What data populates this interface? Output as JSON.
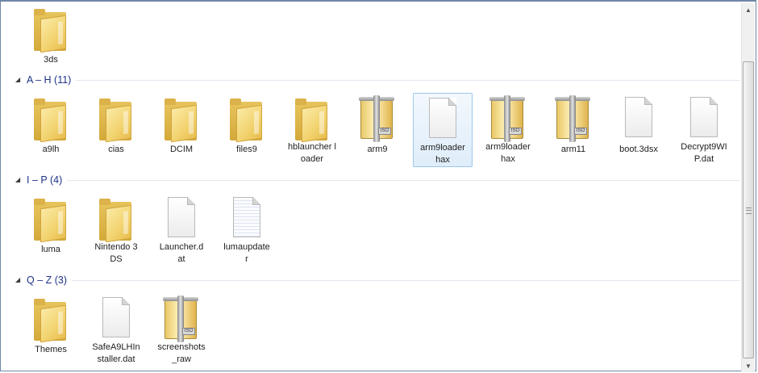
{
  "top_items": [
    {
      "label": "3ds",
      "icon": "folder"
    }
  ],
  "groups": [
    {
      "title": "A – H (11)",
      "items": [
        {
          "label": "a9lh",
          "icon": "folder"
        },
        {
          "label": "cias",
          "icon": "folder"
        },
        {
          "label": "DCIM",
          "icon": "folder"
        },
        {
          "label": "files9",
          "icon": "folder"
        },
        {
          "label": "hblauncher loader",
          "icon": "folder"
        },
        {
          "label": "arm9",
          "icon": "iso"
        },
        {
          "label": "arm9loader hax",
          "icon": "document",
          "selected": true
        },
        {
          "label": "arm9loader hax",
          "icon": "iso"
        },
        {
          "label": "arm11",
          "icon": "iso"
        },
        {
          "label": "boot.3dsx",
          "icon": "document"
        },
        {
          "label": "Decrypt9WIP.dat",
          "icon": "document"
        }
      ]
    },
    {
      "title": "I – P (4)",
      "items": [
        {
          "label": "luma",
          "icon": "folder"
        },
        {
          "label": "Nintendo 3DS",
          "icon": "folder"
        },
        {
          "label": "Launcher.dat",
          "icon": "document"
        },
        {
          "label": "lumaupdater",
          "icon": "document-lined"
        }
      ]
    },
    {
      "title": "Q – Z (3)",
      "items": [
        {
          "label": "Themes",
          "icon": "folder"
        },
        {
          "label": "SafeA9LHInstaller.dat",
          "icon": "document"
        },
        {
          "label": "screenshots_raw",
          "icon": "iso"
        }
      ]
    }
  ],
  "iso_badge": "ISO",
  "colors": {
    "group_title": "#1e3287",
    "selection": "#9ec6ea",
    "frame": "#6f87a6"
  }
}
